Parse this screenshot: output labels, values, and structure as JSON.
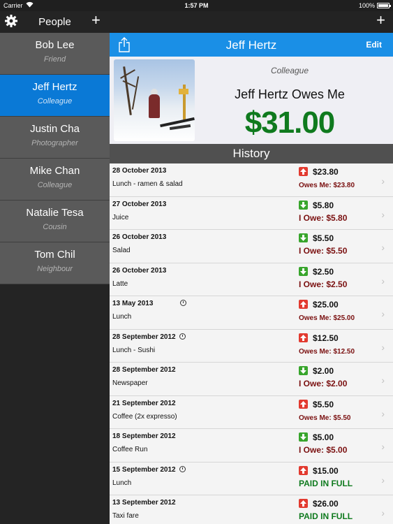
{
  "status_bar": {
    "carrier": "Carrier",
    "time": "1:57 PM",
    "battery": "100%"
  },
  "sidebar": {
    "title": "People",
    "add_label": "+",
    "people": [
      {
        "name": "Bob Lee",
        "relation": "Friend"
      },
      {
        "name": "Jeff Hertz",
        "relation": "Colleague",
        "selected": true
      },
      {
        "name": "Justin Cha",
        "relation": "Photographer"
      },
      {
        "name": "Mike Chan",
        "relation": "Colleague"
      },
      {
        "name": "Natalie Tesa",
        "relation": "Cousin"
      },
      {
        "name": "Tom Chil",
        "relation": "Neighbour"
      }
    ]
  },
  "main": {
    "add_label": "+",
    "nav": {
      "title": "Jeff Hertz",
      "edit_label": "Edit"
    },
    "profile": {
      "relation": "Colleague",
      "owes_text": "Jeff Hertz Owes Me",
      "balance": "$31.00"
    },
    "history_title": "History",
    "history": [
      {
        "date": "28 October 2013",
        "desc": "Lunch - ramen & salad",
        "direction": "up",
        "amount": "$23.80",
        "status": "Owes Me: $23.80",
        "recurring": false
      },
      {
        "date": "27 October 2013",
        "desc": "Juice",
        "direction": "down",
        "amount": "$5.80",
        "status": "I Owe: $5.80",
        "recurring": false
      },
      {
        "date": "26 October 2013",
        "desc": "Salad",
        "direction": "down",
        "amount": "$5.50",
        "status": "I Owe: $5.50",
        "recurring": false
      },
      {
        "date": "26 October 2013",
        "desc": "Latte",
        "direction": "down",
        "amount": "$2.50",
        "status": "I Owe: $2.50",
        "recurring": false
      },
      {
        "date": "13 May 2013",
        "desc": "Lunch",
        "direction": "up",
        "amount": "$25.00",
        "status": "Owes Me: $25.00",
        "recurring": true
      },
      {
        "date": "28 September 2012",
        "desc": "Lunch - Sushi",
        "direction": "up",
        "amount": "$12.50",
        "status": "Owes Me: $12.50",
        "recurring": true
      },
      {
        "date": "28 September 2012",
        "desc": "Newspaper",
        "direction": "down",
        "amount": "$2.00",
        "status": "I Owe: $2.00",
        "recurring": false
      },
      {
        "date": "21 September 2012",
        "desc": "Coffee (2x expresso)",
        "direction": "up",
        "amount": "$5.50",
        "status": "Owes Me: $5.50",
        "recurring": false
      },
      {
        "date": "18 September 2012",
        "desc": "Coffee Run",
        "direction": "down",
        "amount": "$5.00",
        "status": "I Owe: $5.00",
        "recurring": false
      },
      {
        "date": "15 September 2012",
        "desc": "Lunch",
        "direction": "up",
        "amount": "$15.00",
        "status": "PAID IN FULL",
        "recurring": true
      },
      {
        "date": "13 September 2012",
        "desc": "Taxi fare",
        "direction": "up",
        "amount": "$26.00",
        "status": "PAID IN FULL",
        "recurring": false
      }
    ]
  },
  "colors": {
    "accent": "#1a8fe6",
    "selected": "#0a79d6",
    "balance": "#0f7a1e",
    "owe": "#7a1010",
    "up_arrow": "#e23a2f",
    "down_arrow": "#38a52c"
  }
}
